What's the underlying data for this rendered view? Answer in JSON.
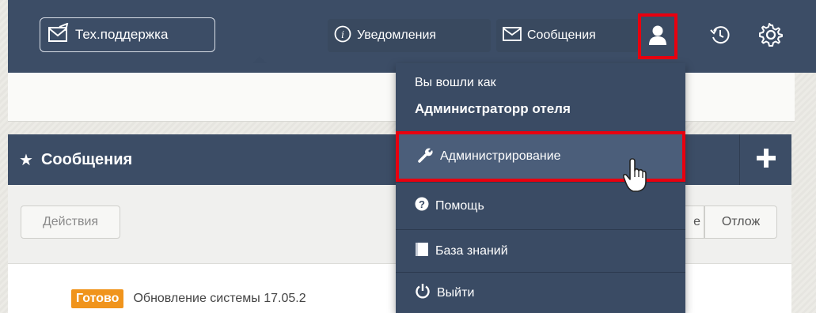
{
  "topbar": {
    "support_label": "Тех.поддержка",
    "notifications_label": "Уведомления",
    "messages_label": "Сообщения"
  },
  "user_menu": {
    "logged_in_as": "Вы вошли как",
    "user_name": "Администраторр отеля",
    "items": [
      {
        "label": "Администрирование",
        "icon": "wrench-icon"
      },
      {
        "label": "Помощь",
        "icon": "question-icon"
      },
      {
        "label": "База знаний",
        "icon": "book-icon"
      },
      {
        "label": "Выйти",
        "icon": "power-icon"
      }
    ]
  },
  "panel": {
    "title": "Сообщения",
    "actions_label": "Действия",
    "partial_button_label": "е",
    "postpone_label": "Отлож",
    "row_badge": "Готово",
    "row_text": "Обновление системы 17.05.2"
  },
  "colors": {
    "navbar": "#3c4d66",
    "highlight": "#e8000f",
    "badge_done": "#f0941c"
  }
}
